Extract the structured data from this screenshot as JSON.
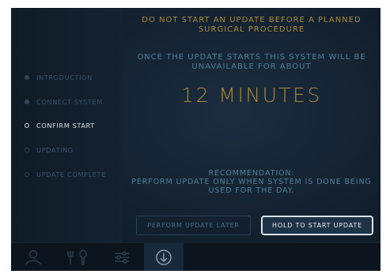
{
  "warning": {
    "line1": "DO NOT START AN UPDATE BEFORE A PLANNED",
    "line2": "SURGICAL PROCEDURE"
  },
  "availability": {
    "line1": "ONCE THE UPDATE STARTS THIS SYSTEM WILL BE",
    "line2": "UNAVAILABLE FOR ABOUT"
  },
  "duration": "12 MINUTES",
  "recommendation": {
    "title": "RECOMMENDATION:",
    "line1": "PERFORM UPDATE ONLY WHEN SYSTEM IS DONE BEING",
    "line2": "USED FOR THE DAY."
  },
  "steps": [
    {
      "label": "INTRODUCTION",
      "state": "done"
    },
    {
      "label": "CONNECT SYSTEM",
      "state": "done"
    },
    {
      "label": "CONFIRM START",
      "state": "active"
    },
    {
      "label": "UPDATING",
      "state": "todo"
    },
    {
      "label": "UPDATE COMPLETE",
      "state": "todo"
    }
  ],
  "buttons": {
    "later": "PERFORM UPDATE LATER",
    "start": "HOLD TO START UPDATE"
  },
  "bottom_nav": [
    {
      "icon": "user-icon",
      "active": false
    },
    {
      "icon": "tools-icon",
      "active": false
    },
    {
      "icon": "sliders-icon",
      "active": false
    },
    {
      "icon": "download-icon",
      "active": true
    }
  ],
  "colors": {
    "accent_gold": "#a8883a",
    "text_teal": "#4e8098",
    "background": "#13202e"
  }
}
